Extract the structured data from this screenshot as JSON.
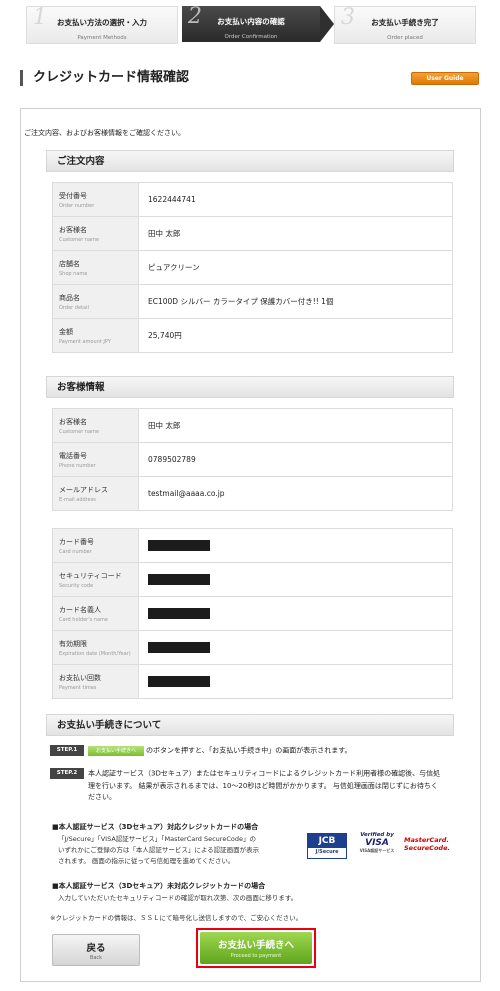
{
  "steps": [
    {
      "num": "1",
      "label": "お支払い方法の選択・入力",
      "sub": "Payment Methods"
    },
    {
      "num": "2",
      "label": "お支払い内容の確認",
      "sub": "Order Confirmation"
    },
    {
      "num": "3",
      "label": "お支払い手続き完了",
      "sub": "Order placed"
    }
  ],
  "header": {
    "title": "クレジットカード情報確認",
    "guide_button": "User Guide (English)"
  },
  "intro": "ご注文内容、およびお客様情報をご確認ください。",
  "order": {
    "heading": "ご注文内容",
    "rows": [
      {
        "label": "受付番号",
        "sub": "Order number",
        "value": "1622444741"
      },
      {
        "label": "お客様名",
        "sub": "Customer name",
        "value": "田中 太郎"
      },
      {
        "label": "店舗名",
        "sub": "Shop name",
        "value": "ピュアクリーン"
      },
      {
        "label": "商品名",
        "sub": "Order detail",
        "value": "EC100D シルバー カラータイプ 保護カバー付き!! 1個"
      },
      {
        "label": "金額",
        "sub": "Payment amount JPY",
        "value": "25,740円"
      }
    ]
  },
  "customer": {
    "heading": "お客様情報",
    "rows": [
      {
        "label": "お客様名",
        "sub": "Customer name",
        "value": "田中 太郎"
      },
      {
        "label": "電話番号",
        "sub": "Phone number",
        "value": "0789502789"
      },
      {
        "label": "メールアドレス",
        "sub": "E-mail address",
        "value": "testmail@aaaa.co.jp"
      }
    ]
  },
  "card": {
    "rows": [
      {
        "label": "カード番号",
        "sub": "Card number"
      },
      {
        "label": "セキュリティコード",
        "sub": "Security code"
      },
      {
        "label": "カード名義人",
        "sub": "Card holder's name"
      },
      {
        "label": "有効期限",
        "sub": "Expiration date (Month/Year)"
      },
      {
        "label": "お支払い回数",
        "sub": "Payment times"
      }
    ]
  },
  "procedure": {
    "heading": "お支払い手続きについて",
    "step1_tag": "STEP.1",
    "step1_button": "お支払い手続きへ",
    "step1_text": "のボタンを押すと、「お支払い手続き中」の画面が表示されます。",
    "step2_tag": "STEP.2",
    "step2_text_1": "本人認証サービス（3Dセキュア）またはセキュリティコードによるクレジットカード利用者様の確認後、与信処",
    "step2_text_2": "理を行います。 結果が表示されるまでは、10～20秒ほど時間がかかります。 与信処理画面は閉じずにお待ちく",
    "step2_text_3": "ださい。",
    "note1_head": "■本人認証サービス（3Dセキュア）対応クレジットカードの場合",
    "note1_body_1": "「J/Secure」「VISA認証サービス」「MasterCard SecureCode」の",
    "note1_body_2": "いずれかにご登録の方は「本人認証サービス」による認証画面が表示",
    "note1_body_3": "されます。 画面の指示に従って与信処理を進めてください。",
    "note2_head": "■本人認証サービス（3Dセキュア）未対応クレジットカードの場合",
    "note2_body": "入力していただいたセキュリティコードの確認が取れ次第、次の画面に移ります。",
    "ssl_note": "※クレジットカードの情報は、ＳＳＬにて暗号化し送信しますので、ご安心ください。",
    "logos": {
      "jcb": "JCB",
      "jcb_sub": "J/Secure",
      "visa_1": "Verified by",
      "visa_2": "VISA",
      "visa_3": "VISA認証サービス",
      "mc_1": "MasterCard.",
      "mc_2": "SecureCode."
    }
  },
  "buttons": {
    "back": "戻る",
    "back_sub": "Back",
    "proceed": "お支払い手続きへ",
    "proceed_sub": "Proceed to payment"
  },
  "colors": {
    "accent_orange": "#de7a06",
    "proceed_green": "#5fa51c",
    "highlight_red": "#e60012"
  }
}
